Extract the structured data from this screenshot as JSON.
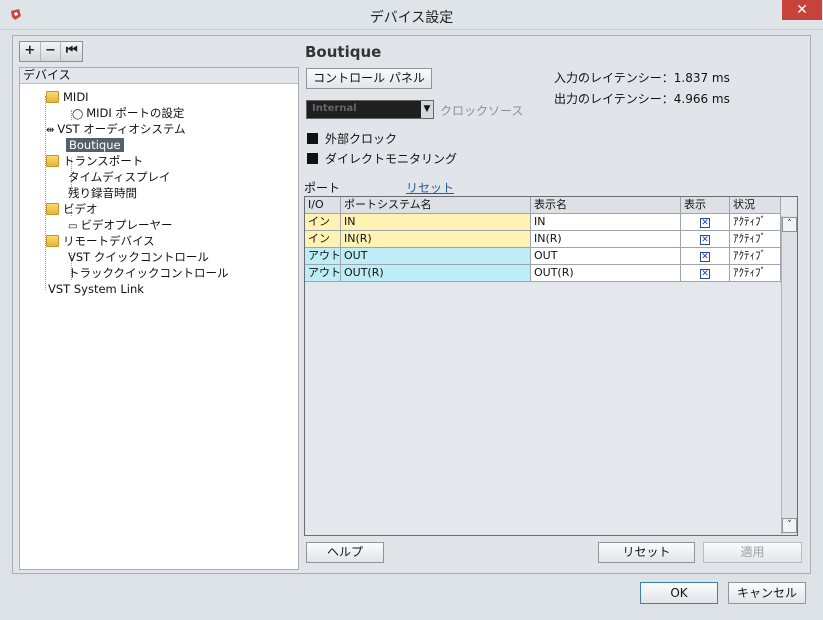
{
  "window": {
    "title": "デバイス設定",
    "close_glyph": "✕",
    "accent": "#c7423a"
  },
  "toolbar": {
    "add_label": "+",
    "remove_label": "−",
    "reset_label": "⏮"
  },
  "tree": {
    "header": "デバイス",
    "items": [
      {
        "label": "MIDI",
        "icon": "folder-icon"
      },
      {
        "label": "MIDI ポートの設定",
        "icon": "midi-port-icon"
      },
      {
        "label": "VST オーディオシステム",
        "icon": "audio-icon"
      },
      {
        "label": "Boutique",
        "selected": true
      },
      {
        "label": "トランスポート",
        "icon": "folder-icon"
      },
      {
        "label": "タイムディスプレイ"
      },
      {
        "label": "残り録音時間"
      },
      {
        "label": "ビデオ",
        "icon": "folder-icon"
      },
      {
        "label": "ビデオプレーヤー",
        "icon": "video-icon"
      },
      {
        "label": "リモートデバイス",
        "icon": "folder-icon"
      },
      {
        "label": "VST クイックコントロール"
      },
      {
        "label": "トラッククイックコントロール"
      },
      {
        "label": "VST System Link"
      }
    ]
  },
  "device": {
    "name": "Boutique",
    "control_panel_label": "コントロール パネル",
    "input_latency": "入力のレイテンシー：1.837 ms",
    "output_latency": "出力のレイテンシー：4.966 ms",
    "clock_source_value": "Internal",
    "clock_source_label": "クロックソース",
    "external_clock_label": "外部クロック",
    "direct_monitoring_label": "ダイレクトモニタリング"
  },
  "ports": {
    "title": "ポート",
    "reset_link": "リセット",
    "columns": [
      "I/O",
      "ポートシステム名",
      "表示名",
      "表示",
      "状況"
    ],
    "rows": [
      {
        "io": "イン",
        "system_name": "IN",
        "display_name": "IN",
        "visible": true,
        "status": "ｱｸﾃｨﾌﾞ"
      },
      {
        "io": "イン",
        "system_name": "IN(R)",
        "display_name": "IN(R)",
        "visible": true,
        "status": "ｱｸﾃｨﾌﾞ"
      },
      {
        "io": "アウト",
        "system_name": "OUT",
        "display_name": "OUT",
        "visible": true,
        "status": "ｱｸﾃｨﾌﾞ"
      },
      {
        "io": "アウト",
        "system_name": "OUT(R)",
        "display_name": "OUT(R)",
        "visible": true,
        "status": "ｱｸﾃｨﾌﾞ"
      }
    ],
    "check_glyph": "✕",
    "scroll_up": "˄",
    "scroll_down": "˅"
  },
  "buttons": {
    "help": "ヘルプ",
    "reset": "リセット",
    "apply": "適用",
    "ok": "OK",
    "cancel": "キャンセル"
  },
  "colors": {
    "input_row": "#fff2b2",
    "output_row": "#bdeef8",
    "selection": "#56606b"
  }
}
